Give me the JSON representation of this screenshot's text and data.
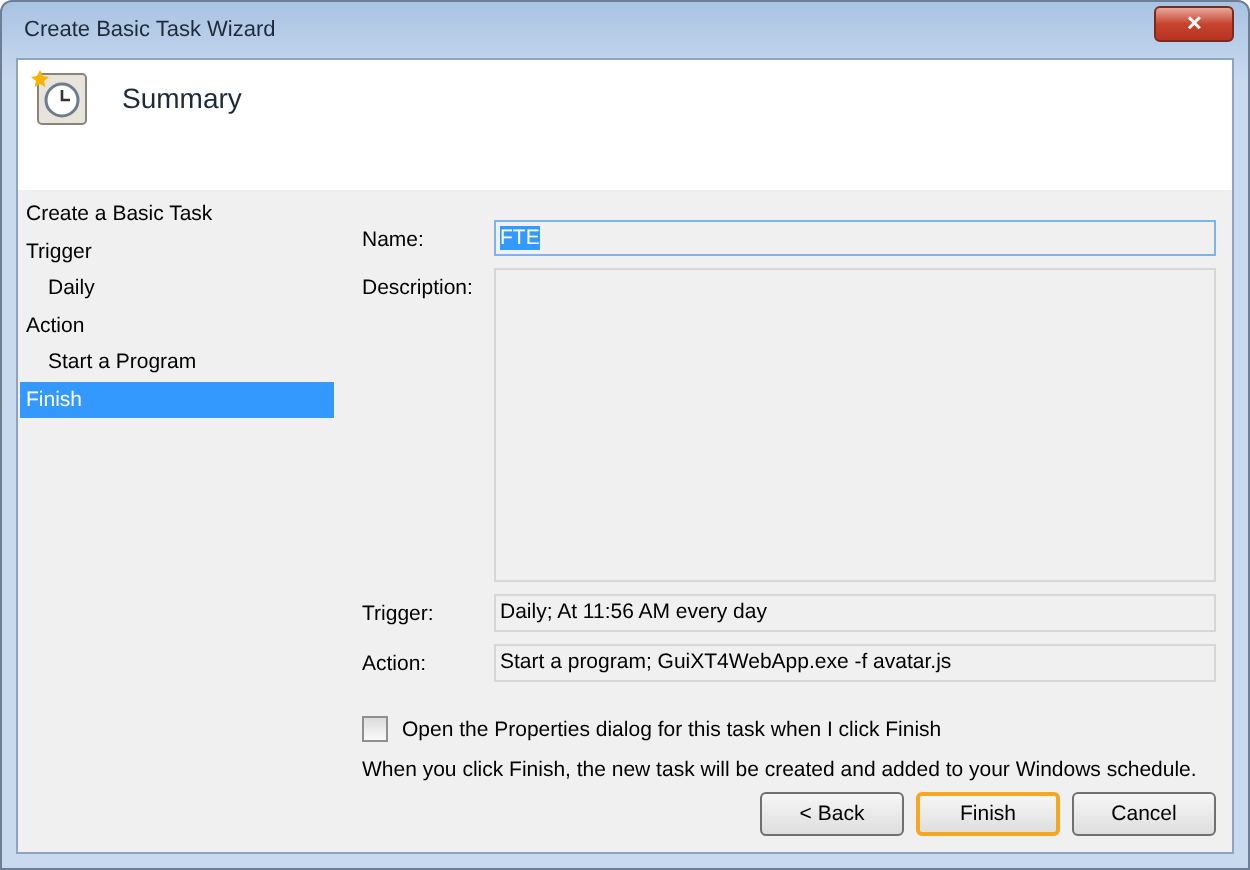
{
  "window": {
    "title": "Create Basic Task Wizard",
    "close": "✕"
  },
  "header": {
    "title": "Summary"
  },
  "steps": [
    {
      "label": "Create a Basic Task",
      "selected": false
    },
    {
      "label": "Trigger",
      "selected": false,
      "children": [
        {
          "label": "Daily",
          "selected": false
        }
      ]
    },
    {
      "label": "Action",
      "selected": false,
      "children": [
        {
          "label": "Start a Program",
          "selected": false
        }
      ]
    },
    {
      "label": "Finish",
      "selected": true
    }
  ],
  "form": {
    "name_label": "Name:",
    "name_value": "FTE",
    "name_selected": true,
    "description_label": "Description:",
    "trigger_label": "Trigger:",
    "trigger_value": "Daily; At 11:56 AM every day",
    "action_label": "Action:",
    "action_value": "Start a program; GuiXT4WebApp.exe -f avatar.js"
  },
  "open_properties": {
    "label": "Open the Properties dialog for this task when I click Finish",
    "checked": false
  },
  "info": "When you click Finish, the new task will be created and added to your Windows schedule.",
  "buttons": [
    {
      "label": "< Back",
      "focused": false
    },
    {
      "label": "Finish",
      "focused": true
    },
    {
      "label": "Cancel",
      "focused": false
    }
  ]
}
